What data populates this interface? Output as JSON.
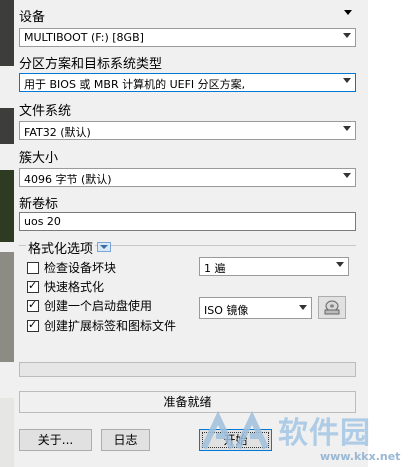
{
  "device": {
    "label": "设备",
    "value": "MULTIBOOT (F:) [8GB]"
  },
  "partition": {
    "label": "分区方案和目标系统类型",
    "value": "用于 BIOS 或 MBR 计算机的 UEFI 分区方案,"
  },
  "filesystem": {
    "label": "文件系统",
    "value": "FAT32 (默认)"
  },
  "cluster": {
    "label": "簇大小",
    "value": "4096 字节 (默认)"
  },
  "volume": {
    "label": "新卷标",
    "value": "uos 20"
  },
  "format_options": {
    "title": "格式化选项",
    "check_bad_blocks": {
      "label": "检查设备坏块",
      "checked": false
    },
    "passes": "1 遍",
    "quick_format": {
      "label": "快速格式化",
      "checked": true
    },
    "bootable": {
      "label": "创建一个启动盘使用",
      "checked": true
    },
    "boot_type": "ISO 镜像",
    "extended_label": {
      "label": "创建扩展标签和图标文件",
      "checked": true
    }
  },
  "progress": {
    "fraction": 0
  },
  "status": "准备就绪",
  "buttons": {
    "about": "关于...",
    "log": "日志",
    "start": "开始"
  },
  "watermark": {
    "text": "软件园",
    "url": "www.kkx.net"
  }
}
